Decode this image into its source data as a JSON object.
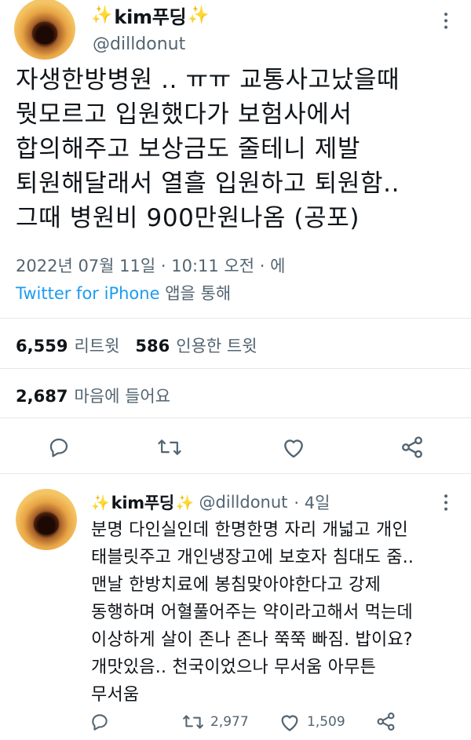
{
  "tweet": {
    "name": "kim푸딩",
    "handle": "@dilldonut",
    "text_lines": [
      "자생한방병원 .. ㅠㅠ 교통사고났을때",
      "뭣모르고 입원했다가 보험사에서",
      "합의해주고 보상금도 줄테니 제발",
      "퇴원해달래서 열흘 입원하고 퇴원함..",
      "그때 병원비 900만원나옴 (공포)"
    ],
    "timestamp": "2022년 07월 11일 · 10:11 오전 · 에",
    "source_app": "Twitter for iPhone",
    "source_suffix": "앱을 통해",
    "stats": {
      "retweets": "6,559",
      "retweets_label": "리트윗",
      "quotes": "586",
      "quotes_label": "인용한 트윗",
      "likes": "2,687",
      "likes_label": "마음에 들어요"
    },
    "actions": [
      "reply-icon",
      "retweet-icon",
      "like-icon",
      "share-icon"
    ]
  },
  "reply": {
    "name": "kim푸딩",
    "handle": "@dilldonut",
    "age": "· 4일",
    "text_lines": [
      "분명 다인실인데 한명한명 자리 개넓고 개인",
      "태블릿주고 개인냉장고에 보호자 침대도 줌..",
      "맨날 한방치료에 봉침맞아야한다고 강제",
      "동행하며 어혈풀어주는 약이라고해서 먹는데",
      "이상하게 살이 존나 존나 쭉쭉 빠짐. 밥이요?",
      "개맛있음.. 천국이었으나 무서움 아무튼",
      "무서움"
    ],
    "reply_count": "",
    "retweet_count": "2,977",
    "like_count": "1,509"
  },
  "colors": {
    "accent": "#1d9bf0",
    "text": "#0f1419",
    "muted": "#536471",
    "divider": "#e6e9ec",
    "sparkle": "#f5c518"
  }
}
